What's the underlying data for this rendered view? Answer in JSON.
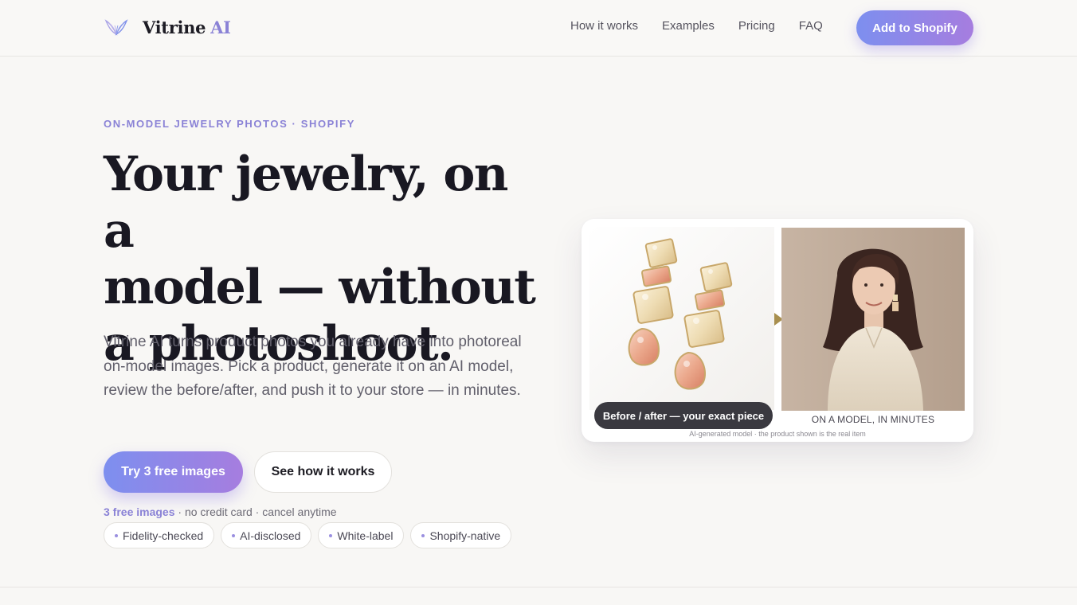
{
  "nav": {
    "brand_name": "Vitrine",
    "brand_ai": "AI",
    "links": [
      "How it works",
      "Examples",
      "Pricing",
      "FAQ"
    ],
    "cta": "Add to Shopify",
    "logo_icon": "butterfly-wings-icon"
  },
  "hero": {
    "eyebrow": "ON-MODEL JEWELRY PHOTOS · SHOPIFY",
    "headline_line1": "Your jewelry, on a",
    "headline_line2": "model — without",
    "headline_line3": "a photoshoot.",
    "subtext": "Vitrine AI turns product photos you already have into photoreal on-model images. Pick a product, generate it on an AI model, review the before/after, and push it to your store — in minutes.",
    "primary_cta": "Try 3 free images",
    "secondary_cta": "See how it works",
    "note_accent": "3 free images",
    "note_rest": " · no credit card · cancel anytime",
    "chips": [
      "Fidelity-checked",
      "AI-disclosed",
      "White-label",
      "Shopify-native"
    ]
  },
  "preview": {
    "pill": "Before / after — your exact piece",
    "after_caption": "ON A MODEL, IN MINUTES",
    "disclaimer": "AI-generated model · the product shown is the real item"
  },
  "colors": {
    "accent": "#8a82d6",
    "gradient_start": "#7d8fef",
    "gradient_end": "#a67ddf",
    "background": "#f8f7f5"
  }
}
